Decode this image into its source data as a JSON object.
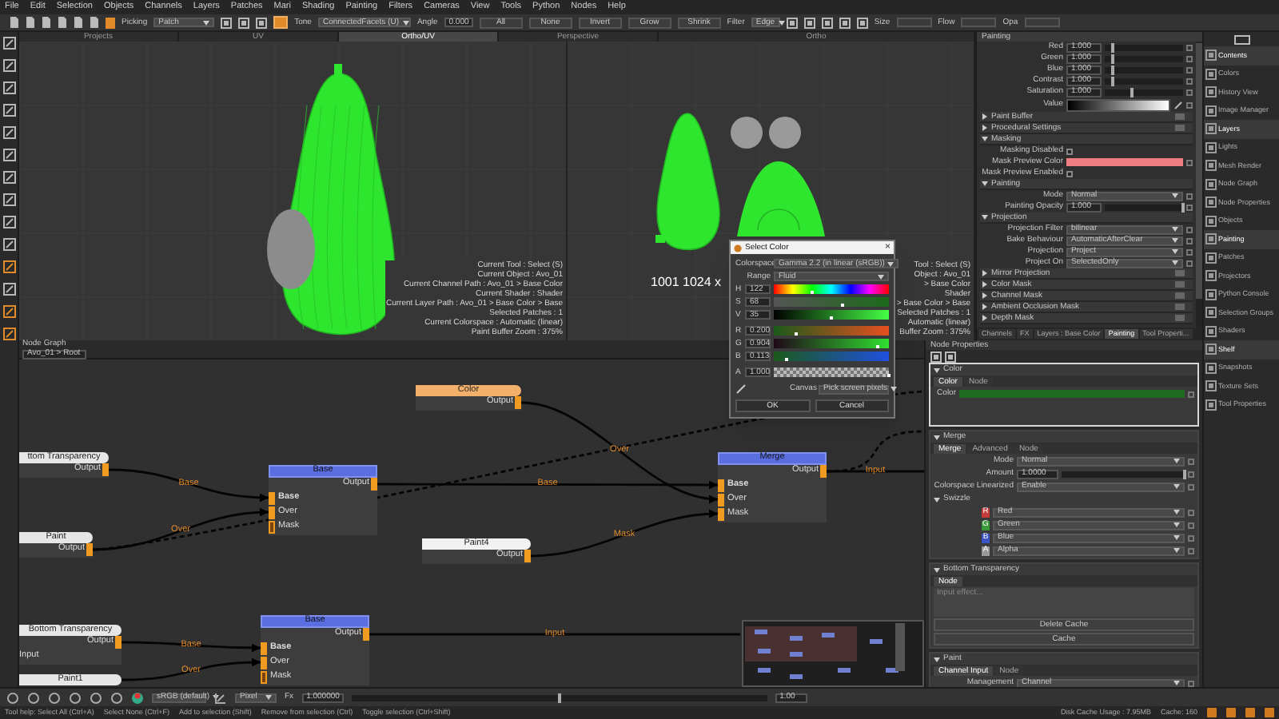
{
  "menu": [
    "File",
    "Edit",
    "Selection",
    "Objects",
    "Channels",
    "Layers",
    "Patches",
    "Mari",
    "Shading",
    "Painting",
    "Filters",
    "Cameras",
    "View",
    "Tools",
    "Python",
    "Nodes",
    "Help"
  ],
  "toolbar": {
    "picking": {
      "label": "Picking",
      "value": "Patch"
    },
    "tone": {
      "label": "Tone",
      "value": "ConnectedFacets (U)"
    },
    "angle": {
      "label": "Angle",
      "value": "0.000"
    },
    "buttons": [
      "All",
      "None",
      "Invert",
      "Grow",
      "Shrink"
    ],
    "filter": {
      "label": "Filter",
      "value": "Edge"
    },
    "fields": [
      "Size",
      "Flow",
      "Opa"
    ]
  },
  "tools": [
    {
      "selected": false
    },
    {
      "selected": false
    },
    {
      "selected": false
    },
    {
      "selected": false
    },
    {
      "selected": false
    },
    {
      "selected": false
    },
    {
      "selected": false
    },
    {
      "selected": false
    },
    {
      "selected": false
    },
    {
      "selected": false
    },
    {
      "selected": true
    },
    {
      "selected": false
    },
    {
      "selected": true
    },
    {
      "selected": true
    }
  ],
  "view_tabs": [
    {
      "label": "Projects",
      "selected": false
    },
    {
      "label": "UV",
      "selected": false
    },
    {
      "label": "Ortho/UV",
      "selected": true
    },
    {
      "label": "Perspective",
      "selected": false
    },
    {
      "label": "Ortho",
      "selected": false
    }
  ],
  "viewport": {
    "info": [
      "Current Tool : Select (S)",
      "Current Object : Avo_01",
      "Current Channel Path : Avo_01 > Base Color",
      "Current Shader : Shader",
      "Current Layer Path : Avo_01 > Base Color > Base",
      "Selected Patches : 1",
      "Current Colorspace : Automatic (linear)",
      "Paint Buffer Zoom : 375%"
    ],
    "uv_info": [
      "Tool : Select (S)",
      "Object : Avo_01",
      "> Base Color",
      "Shader",
      "> Base Color > Base",
      "Selected Patches : 1",
      "Automatic (linear)",
      "Buffer Zoom : 375%"
    ],
    "uv_label": "1001 1024 x"
  },
  "color_dialog": {
    "title": "Select Color",
    "close": "×",
    "colorspace": {
      "label": "Colorspace",
      "value": "Gamma 2.2 (in linear (sRGB))"
    },
    "range": {
      "label": "Range",
      "value": "Fluid"
    },
    "channels": [
      {
        "letter": "H",
        "value": "122",
        "kind": "hue",
        "level": 0.34
      },
      {
        "letter": "S",
        "value": "68",
        "kind": "sat",
        "level": 0.6
      },
      {
        "letter": "V",
        "value": "35",
        "kind": "val",
        "level": 0.5
      },
      {
        "letter": "R",
        "value": "0.200",
        "kind": "red",
        "level": 0.2
      },
      {
        "letter": "G",
        "value": "0.904",
        "kind": "green",
        "level": 0.9
      },
      {
        "letter": "B",
        "value": "0.113",
        "kind": "blue",
        "level": 0.11
      },
      {
        "letter": "A",
        "value": "1.000",
        "kind": "alpha",
        "level": 1
      }
    ],
    "canvas": {
      "label": "Canvas",
      "value": "Pick screen pixels"
    },
    "buttons": [
      "OK",
      "Cancel"
    ]
  },
  "painting_panel": {
    "title": "Painting",
    "rows": [
      {
        "kind": "slider",
        "label": "Red",
        "value": "1.000",
        "level": 0.1
      },
      {
        "kind": "slider",
        "label": "Green",
        "value": "1.000",
        "level": 0.1
      },
      {
        "kind": "slider",
        "label": "Blue",
        "value": "1.000",
        "level": 0.1
      },
      {
        "kind": "slider",
        "label": "Contrast",
        "value": "1.000",
        "level": 0.1
      },
      {
        "kind": "slider",
        "label": "Saturation",
        "value": "1.000",
        "level": 0.35
      },
      {
        "kind": "gradient",
        "label": "Value"
      },
      {
        "kind": "section",
        "label": "Paint Buffer",
        "expanded": false
      },
      {
        "kind": "section",
        "label": "Procedural Settings",
        "expanded": false
      },
      {
        "kind": "section",
        "label": "Masking",
        "expanded": true
      },
      {
        "kind": "check",
        "label": "Masking Disabled",
        "checked": false
      },
      {
        "kind": "swatch",
        "label": "Mask Preview Color",
        "color": "#f07c84"
      },
      {
        "kind": "check",
        "label": "Mask Preview Enabled",
        "checked": false
      },
      {
        "kind": "section",
        "label": "Painting",
        "expanded": true
      },
      {
        "kind": "dropdown",
        "label": "Mode",
        "value": "Normal"
      },
      {
        "kind": "slider",
        "label": "Painting Opacity",
        "value": "1.000",
        "level": 1
      },
      {
        "kind": "section",
        "label": "Projection",
        "expanded": true
      },
      {
        "kind": "dropdown",
        "label": "Projection Filter",
        "value": "bilinear"
      },
      {
        "kind": "dropdown",
        "label": "Bake Behaviour",
        "value": "AutomaticAfterClear"
      },
      {
        "kind": "dropdown",
        "label": "Projection",
        "value": "Project"
      },
      {
        "kind": "dropdown",
        "label": "Project On",
        "value": "SelectedOnly"
      },
      {
        "kind": "section",
        "label": "Mirror Projection",
        "expanded": false
      },
      {
        "kind": "section",
        "label": "Color Mask",
        "expanded": false
      },
      {
        "kind": "section",
        "label": "Channel Mask",
        "expanded": false
      },
      {
        "kind": "section",
        "label": "Ambient Occlusion Mask",
        "expanded": false
      },
      {
        "kind": "section",
        "label": "Depth Mask",
        "expanded": false
      }
    ],
    "tabs": [
      {
        "label": "Channels",
        "selected": false
      },
      {
        "label": "FX",
        "selected": false
      },
      {
        "label": "Layers : Base Color",
        "selected": false
      },
      {
        "label": "Painting",
        "selected": true
      },
      {
        "label": "Tool Properti...",
        "selected": false
      }
    ]
  },
  "palettes": [
    {
      "label": "Contents",
      "selected": true
    },
    {
      "label": "Colors",
      "selected": false
    },
    {
      "label": "History View",
      "selected": false
    },
    {
      "label": "Image Manager",
      "selected": false
    },
    {
      "label": "Layers",
      "selected": true
    },
    {
      "label": "Lights",
      "selected": false
    },
    {
      "label": "Mesh Render",
      "selected": false
    },
    {
      "label": "Node Graph",
      "selected": false
    },
    {
      "label": "Node Properties",
      "selected": false
    },
    {
      "label": "Objects",
      "selected": false
    },
    {
      "label": "Painting",
      "selected": true
    },
    {
      "label": "Patches",
      "selected": false
    },
    {
      "label": "Projectors",
      "selected": false
    },
    {
      "label": "Python Console",
      "selected": false
    },
    {
      "label": "Selection Groups",
      "selected": false
    },
    {
      "label": "Shaders",
      "selected": false
    },
    {
      "label": "Shelf",
      "selected": true
    },
    {
      "label": "Snapshots",
      "selected": false
    },
    {
      "label": "Texture Sets",
      "selected": false
    },
    {
      "label": "Tool Properties",
      "selected": false
    }
  ],
  "node_graph": {
    "title": "Node Graph",
    "path": "Avo_01 > Root",
    "nodes": [
      {
        "title": "Color",
        "kind": "source",
        "color": "#f3b06a",
        "outputs": "Output"
      },
      {
        "title": "ttom Transparency",
        "kind": "source",
        "color": "#e6e6e6",
        "outputs": "Output"
      },
      {
        "title": "Paint",
        "kind": "source",
        "color": "#e6e6e6",
        "outputs": "Output"
      },
      {
        "title": "Base",
        "kind": "operator",
        "color": "#5a6ee0",
        "outputs": "Output",
        "inputs": [
          {
            "label": "Base",
            "primary": true,
            "connected": true
          },
          {
            "label": "Over",
            "primary": false,
            "connected": true
          },
          {
            "label": "Mask",
            "primary": false,
            "connected": false
          }
        ]
      },
      {
        "title": "Paint4",
        "kind": "source",
        "color": "#f2f2f2",
        "outputs": "Output"
      },
      {
        "title": "Merge",
        "kind": "operator",
        "color": "#5a6ee0",
        "outputs": "Output",
        "inputs": [
          {
            "label": "Base",
            "primary": true,
            "connected": true
          },
          {
            "label": "Over",
            "primary": false,
            "connected": true
          },
          {
            "label": "Mask",
            "primary": false,
            "connected": true
          }
        ]
      },
      {
        "title": "Bottom Transparency",
        "kind": "source",
        "color": "#e6e6e6",
        "outputs": "Output",
        "inputs": [
          {
            "label": "Input",
            "primary": false
          }
        ]
      },
      {
        "title": "Base",
        "kind": "operator",
        "color": "#5a6ee0",
        "outputs": "Output",
        "inputs": [
          {
            "label": "Base",
            "primary": true,
            "connected": true
          },
          {
            "label": "Over",
            "primary": false,
            "connected": true
          },
          {
            "label": "Mask",
            "primary": false,
            "connected": false
          }
        ]
      },
      {
        "title": "Paint1",
        "kind": "source",
        "color": "#e6e6e6"
      }
    ],
    "edges": [
      {
        "label": "Base"
      },
      {
        "label": "Over"
      },
      {
        "label": "Over"
      },
      {
        "label": "Base"
      },
      {
        "label": "Mask"
      },
      {
        "label": "Input"
      },
      {
        "label": "Base"
      },
      {
        "label": "Over"
      },
      {
        "label": "Input"
      }
    ]
  },
  "node_properties": {
    "title": "Node Properties",
    "sections": [
      {
        "title": "Color",
        "selected": true,
        "tabs": [
          {
            "label": "Color",
            "selected": true
          },
          {
            "label": "Node",
            "selected": false
          }
        ],
        "rows": [
          {
            "kind": "swatch",
            "label": "Color",
            "color": "#1e6a1e"
          }
        ]
      },
      {
        "title": "Merge",
        "selected": false,
        "tabs": [
          {
            "label": "Merge",
            "selected": true
          },
          {
            "label": "Advanced",
            "selected": false
          },
          {
            "label": "Node",
            "selected": false
          }
        ],
        "rows": [
          {
            "kind": "dropdown",
            "label": "Mode",
            "value": "Normal"
          },
          {
            "kind": "slider",
            "label": "Amount",
            "value": "1.0000",
            "level": 1
          },
          {
            "kind": "dropdown",
            "label": "Colorspace Linearized",
            "value": "Enable"
          },
          {
            "kind": "group",
            "label": "Swizzle"
          },
          {
            "kind": "channel",
            "letter": "R",
            "value": "Red",
            "color": "#c23a3a"
          },
          {
            "kind": "channel",
            "letter": "G",
            "value": "Green",
            "color": "#3a9a3a"
          },
          {
            "kind": "channel",
            "letter": "B",
            "value": "Blue",
            "color": "#3a55c2"
          },
          {
            "kind": "channel",
            "letter": "A",
            "value": "Alpha",
            "color": "#9a9a9a"
          }
        ]
      },
      {
        "title": "Bottom Transparency",
        "selected": false,
        "tabs": [
          {
            "label": "Node",
            "selected": true
          }
        ],
        "rows": [
          {
            "kind": "textarea",
            "placeholder": "Input effect..."
          },
          {
            "kind": "button",
            "label": "Delete Cache"
          },
          {
            "kind": "button",
            "label": "Cache"
          }
        ]
      },
      {
        "title": "Paint",
        "selected": false,
        "tabs": [
          {
            "label": "Channel Input",
            "selected": true
          },
          {
            "label": "Node",
            "selected": false
          }
        ],
        "rows": [
          {
            "kind": "dropdown",
            "label": "Management",
            "value": "Channel"
          }
        ]
      }
    ]
  },
  "bottom_bar": {
    "colorspace": "sRGB (default)",
    "filter": "Pixel",
    "fx": "Fx",
    "value": "1.000000",
    "level": 0.5,
    "zoom": "1.00"
  },
  "status_bar": {
    "help": [
      "Tool help: Select All (Ctrl+A)",
      "Select None (Ctrl+F)",
      "Add to selection (Shift)",
      "Remove from selection (Ctrl)",
      "Toggle selection (Ctrl+Shift)"
    ],
    "cache": "Disk Cache Usage : 7.95MB",
    "memory": "Cache: 160"
  }
}
